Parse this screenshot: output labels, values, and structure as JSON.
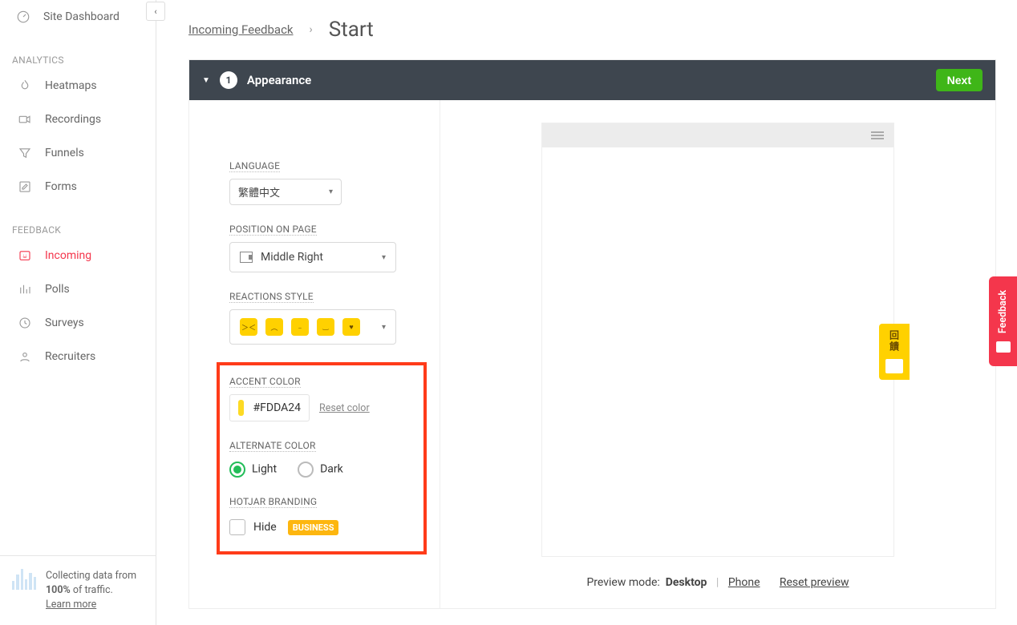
{
  "sidebar": {
    "dashboard": "Site Dashboard",
    "groups": {
      "analytics": {
        "title": "ANALYTICS",
        "items": [
          "Heatmaps",
          "Recordings",
          "Funnels",
          "Forms"
        ]
      },
      "feedback": {
        "title": "FEEDBACK",
        "items": [
          "Incoming",
          "Polls",
          "Surveys",
          "Recruiters"
        ],
        "activeIndex": 0
      }
    },
    "collector": {
      "line1": "Collecting data from",
      "pct": "100%",
      "line2_rest": " of traffic.",
      "learn": "Learn more"
    }
  },
  "breadcrumb": {
    "back": "Incoming Feedback",
    "current": "Start"
  },
  "wizard": {
    "step_num": "1",
    "step_title": "Appearance",
    "next": "Next",
    "form": {
      "language_label": "LANGUAGE",
      "language_value": "繁體中文",
      "position_label": "POSITION ON PAGE",
      "position_value": "Middle Right",
      "reactions_label": "REACTIONS STYLE",
      "accent_label": "ACCENT COLOR",
      "accent_value": "#FDDA24",
      "reset": "Reset color",
      "alt_label": "ALTERNATE COLOR",
      "alt_light": "Light",
      "alt_dark": "Dark",
      "brand_label": "HOTJAR BRANDING",
      "brand_hide": "Hide",
      "brand_tag": "BUSINESS"
    },
    "preview": {
      "widget_text": "回饋",
      "footer_label": "Preview mode:",
      "mode_desktop": "Desktop",
      "mode_phone": "Phone",
      "reset": "Reset preview"
    }
  },
  "side_tab": "Feedback",
  "colors": {
    "accent": "#FDDA24"
  }
}
